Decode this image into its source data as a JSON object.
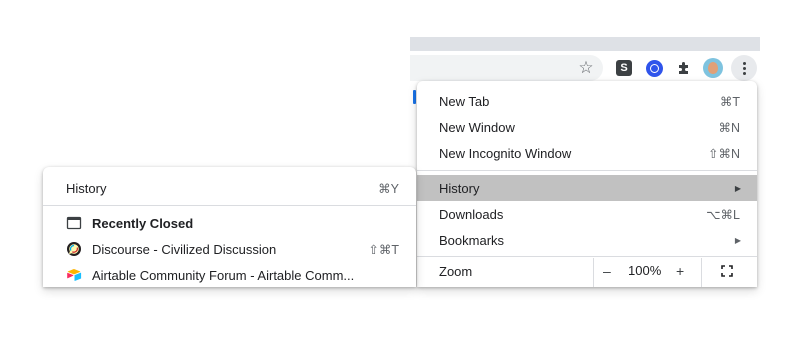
{
  "toolbar": {
    "icons": [
      "star-icon",
      "extension-s-icon",
      "extension-blue-icon",
      "puzzle-icon",
      "avatar-icon",
      "more-vert-icon"
    ],
    "ext_s_letter": "S"
  },
  "main_menu": {
    "items": [
      {
        "label": "New Tab",
        "shortcut": "⌘T"
      },
      {
        "label": "New Window",
        "shortcut": "⌘N"
      },
      {
        "label": "New Incognito Window",
        "shortcut": "⇧⌘N"
      },
      {
        "label": "History",
        "arrow": "▶"
      },
      {
        "label": "Downloads",
        "shortcut": "⌥⌘L"
      },
      {
        "label": "Bookmarks",
        "arrow": "▶"
      }
    ],
    "zoom": {
      "label": "Zoom",
      "minus": "–",
      "value": "100%",
      "plus": "+"
    }
  },
  "history_menu": {
    "header": {
      "label": "History",
      "shortcut": "⌘Y"
    },
    "recently_closed_label": "Recently Closed",
    "entries": [
      {
        "title": "Discourse - Civilized Discussion",
        "shortcut": "⇧⌘T"
      },
      {
        "title": "Airtable Community Forum - Airtable Comm..."
      }
    ]
  },
  "colors": {
    "highlight": "#c1c1c1",
    "menu_bg": "#ffffff",
    "separator": "#dadce0"
  }
}
